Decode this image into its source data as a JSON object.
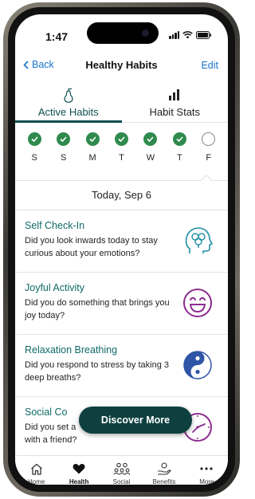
{
  "status_bar": {
    "time": "1:47"
  },
  "navbar": {
    "back_label": "Back",
    "title": "Healthy Habits",
    "edit_label": "Edit"
  },
  "tabs": [
    {
      "label": "Active Habits",
      "icon": "pear-icon",
      "active": true
    },
    {
      "label": "Habit Stats",
      "icon": "bar-chart-icon",
      "active": false
    }
  ],
  "week": [
    {
      "label": "S",
      "done": true
    },
    {
      "label": "S",
      "done": true
    },
    {
      "label": "M",
      "done": true
    },
    {
      "label": "T",
      "done": true
    },
    {
      "label": "W",
      "done": true
    },
    {
      "label": "T",
      "done": true
    },
    {
      "label": "F",
      "done": false
    }
  ],
  "date_label": "Today, Sep 6",
  "habits": [
    {
      "title": "Self Check-In",
      "question": "Did you look inwards today to stay curious about your emotions?",
      "icon": "brain-head-icon",
      "color": "#1f8fa3"
    },
    {
      "title": "Joyful Activity",
      "question": "Did you do something that brings you joy today?",
      "icon": "smile-icon",
      "color": "#8b2b8f"
    },
    {
      "title": "Relaxation Breathing",
      "question": "Did you respond to stress by taking 3 deep breaths?",
      "icon": "yin-yang-icon",
      "color": "#2f55a6"
    },
    {
      "title": "Social Co",
      "question_line1": "Did you set a",
      "question_line2": "with a friend?",
      "icon": "clock-icon",
      "color": "#8b2b8f"
    }
  ],
  "discover_label": "Discover More",
  "bottom_tabs": [
    {
      "label": "Home",
      "icon": "home-icon"
    },
    {
      "label": "Health",
      "icon": "heart-icon",
      "active": true
    },
    {
      "label": "Social",
      "icon": "people-icon"
    },
    {
      "label": "Benefits",
      "icon": "hand-icon"
    },
    {
      "label": "More",
      "icon": "more-icon"
    }
  ],
  "colors": {
    "accent": "#0f4f52",
    "link": "#1a73c9",
    "done": "#2f8a4e"
  }
}
